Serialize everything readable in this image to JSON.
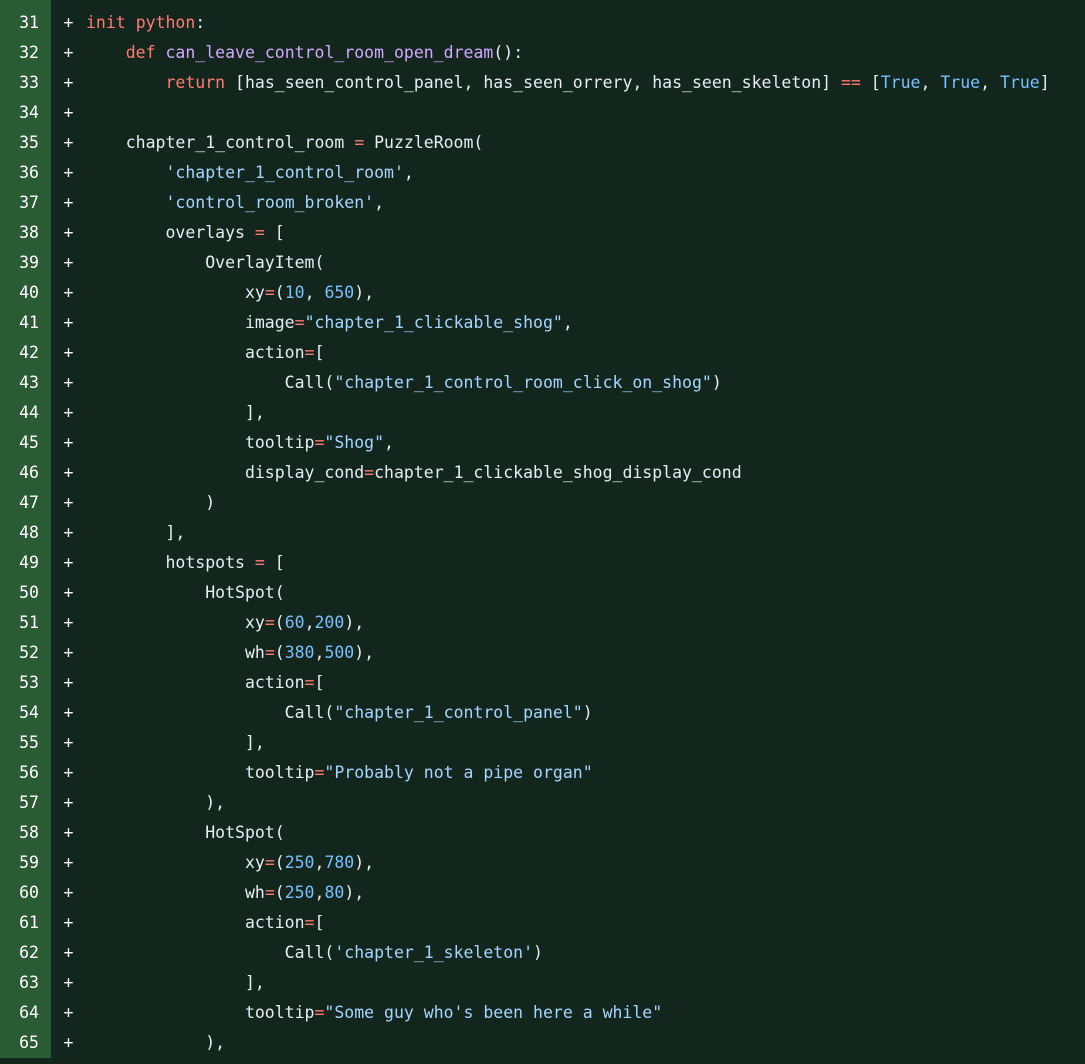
{
  "colors": {
    "background": "#12261e",
    "gutter": "#2a5b35",
    "keyword": "#ff7b72",
    "function": "#d2a8ff",
    "string": "#a5d6ff",
    "number": "#79c0ff",
    "text": "#e6edf3"
  },
  "diff": {
    "marker": "+",
    "lines": [
      {
        "num": "31",
        "tokens": [
          [
            "kw",
            "init"
          ],
          [
            "plain",
            " "
          ],
          [
            "kw",
            "python"
          ],
          [
            "plain",
            ":"
          ]
        ]
      },
      {
        "num": "32",
        "tokens": [
          [
            "plain",
            "    "
          ],
          [
            "kw",
            "def"
          ],
          [
            "plain",
            " "
          ],
          [
            "fn",
            "can_leave_control_room_open_dream"
          ],
          [
            "plain",
            "():"
          ]
        ]
      },
      {
        "num": "33",
        "tokens": [
          [
            "plain",
            "        "
          ],
          [
            "kw",
            "return"
          ],
          [
            "plain",
            " [has_seen_control_panel, has_seen_orrery, has_seen_skeleton] "
          ],
          [
            "op",
            "=="
          ],
          [
            "plain",
            " ["
          ],
          [
            "bool",
            "True"
          ],
          [
            "plain",
            ", "
          ],
          [
            "bool",
            "True"
          ],
          [
            "plain",
            ", "
          ],
          [
            "bool",
            "True"
          ],
          [
            "plain",
            "]"
          ]
        ]
      },
      {
        "num": "34",
        "tokens": []
      },
      {
        "num": "35",
        "tokens": [
          [
            "plain",
            "    chapter_1_control_room "
          ],
          [
            "op",
            "="
          ],
          [
            "plain",
            " PuzzleRoom("
          ]
        ]
      },
      {
        "num": "36",
        "tokens": [
          [
            "plain",
            "        "
          ],
          [
            "str",
            "'chapter_1_control_room'"
          ],
          [
            "plain",
            ","
          ]
        ]
      },
      {
        "num": "37",
        "tokens": [
          [
            "plain",
            "        "
          ],
          [
            "str",
            "'control_room_broken'"
          ],
          [
            "plain",
            ","
          ]
        ]
      },
      {
        "num": "38",
        "tokens": [
          [
            "plain",
            "        overlays "
          ],
          [
            "op",
            "="
          ],
          [
            "plain",
            " ["
          ]
        ]
      },
      {
        "num": "39",
        "tokens": [
          [
            "plain",
            "            OverlayItem("
          ]
        ]
      },
      {
        "num": "40",
        "tokens": [
          [
            "plain",
            "                xy"
          ],
          [
            "op",
            "="
          ],
          [
            "plain",
            "("
          ],
          [
            "num",
            "10"
          ],
          [
            "plain",
            ", "
          ],
          [
            "num",
            "650"
          ],
          [
            "plain",
            "),"
          ]
        ]
      },
      {
        "num": "41",
        "tokens": [
          [
            "plain",
            "                image"
          ],
          [
            "op",
            "="
          ],
          [
            "str",
            "\"chapter_1_clickable_shog\""
          ],
          [
            "plain",
            ","
          ]
        ]
      },
      {
        "num": "42",
        "tokens": [
          [
            "plain",
            "                action"
          ],
          [
            "op",
            "="
          ],
          [
            "plain",
            "["
          ]
        ]
      },
      {
        "num": "43",
        "tokens": [
          [
            "plain",
            "                    Call("
          ],
          [
            "str",
            "\"chapter_1_control_room_click_on_shog\""
          ],
          [
            "plain",
            ")"
          ]
        ]
      },
      {
        "num": "44",
        "tokens": [
          [
            "plain",
            "                ],"
          ]
        ]
      },
      {
        "num": "45",
        "tokens": [
          [
            "plain",
            "                tooltip"
          ],
          [
            "op",
            "="
          ],
          [
            "str",
            "\"Shog\""
          ],
          [
            "plain",
            ","
          ]
        ]
      },
      {
        "num": "46",
        "tokens": [
          [
            "plain",
            "                display_cond"
          ],
          [
            "op",
            "="
          ],
          [
            "plain",
            "chapter_1_clickable_shog_display_cond"
          ]
        ]
      },
      {
        "num": "47",
        "tokens": [
          [
            "plain",
            "            )"
          ]
        ]
      },
      {
        "num": "48",
        "tokens": [
          [
            "plain",
            "        ],"
          ]
        ]
      },
      {
        "num": "49",
        "tokens": [
          [
            "plain",
            "        hotspots "
          ],
          [
            "op",
            "="
          ],
          [
            "plain",
            " ["
          ]
        ]
      },
      {
        "num": "50",
        "tokens": [
          [
            "plain",
            "            HotSpot("
          ]
        ]
      },
      {
        "num": "51",
        "tokens": [
          [
            "plain",
            "                xy"
          ],
          [
            "op",
            "="
          ],
          [
            "plain",
            "("
          ],
          [
            "num",
            "60"
          ],
          [
            "plain",
            ","
          ],
          [
            "num",
            "200"
          ],
          [
            "plain",
            "),"
          ]
        ]
      },
      {
        "num": "52",
        "tokens": [
          [
            "plain",
            "                wh"
          ],
          [
            "op",
            "="
          ],
          [
            "plain",
            "("
          ],
          [
            "num",
            "380"
          ],
          [
            "plain",
            ","
          ],
          [
            "num",
            "500"
          ],
          [
            "plain",
            "),"
          ]
        ]
      },
      {
        "num": "53",
        "tokens": [
          [
            "plain",
            "                action"
          ],
          [
            "op",
            "="
          ],
          [
            "plain",
            "["
          ]
        ]
      },
      {
        "num": "54",
        "tokens": [
          [
            "plain",
            "                    Call("
          ],
          [
            "str",
            "\"chapter_1_control_panel\""
          ],
          [
            "plain",
            ")"
          ]
        ]
      },
      {
        "num": "55",
        "tokens": [
          [
            "plain",
            "                ],"
          ]
        ]
      },
      {
        "num": "56",
        "tokens": [
          [
            "plain",
            "                tooltip"
          ],
          [
            "op",
            "="
          ],
          [
            "str",
            "\"Probably not a pipe organ\""
          ]
        ]
      },
      {
        "num": "57",
        "tokens": [
          [
            "plain",
            "            ),"
          ]
        ]
      },
      {
        "num": "58",
        "tokens": [
          [
            "plain",
            "            HotSpot("
          ]
        ]
      },
      {
        "num": "59",
        "tokens": [
          [
            "plain",
            "                xy"
          ],
          [
            "op",
            "="
          ],
          [
            "plain",
            "("
          ],
          [
            "num",
            "250"
          ],
          [
            "plain",
            ","
          ],
          [
            "num",
            "780"
          ],
          [
            "plain",
            "),"
          ]
        ]
      },
      {
        "num": "60",
        "tokens": [
          [
            "plain",
            "                wh"
          ],
          [
            "op",
            "="
          ],
          [
            "plain",
            "("
          ],
          [
            "num",
            "250"
          ],
          [
            "plain",
            ","
          ],
          [
            "num",
            "80"
          ],
          [
            "plain",
            "),"
          ]
        ]
      },
      {
        "num": "61",
        "tokens": [
          [
            "plain",
            "                action"
          ],
          [
            "op",
            "="
          ],
          [
            "plain",
            "["
          ]
        ]
      },
      {
        "num": "62",
        "tokens": [
          [
            "plain",
            "                    Call("
          ],
          [
            "str",
            "'chapter_1_skeleton'"
          ],
          [
            "plain",
            ")"
          ]
        ]
      },
      {
        "num": "63",
        "tokens": [
          [
            "plain",
            "                ],"
          ]
        ]
      },
      {
        "num": "64",
        "tokens": [
          [
            "plain",
            "                tooltip"
          ],
          [
            "op",
            "="
          ],
          [
            "str",
            "\"Some guy who's been here a while\""
          ]
        ]
      },
      {
        "num": "65",
        "tokens": [
          [
            "plain",
            "            ),"
          ]
        ]
      }
    ]
  }
}
